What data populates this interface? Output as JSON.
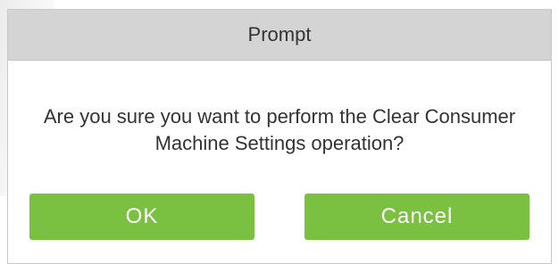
{
  "dialog": {
    "title": "Prompt",
    "message": "Are you sure you want to perform the Clear Consumer Machine Settings operation?",
    "buttons": {
      "ok_label": "OK",
      "cancel_label": "Cancel"
    },
    "colors": {
      "header_bg": "#d4d4d4",
      "button_bg": "#7ac142",
      "button_text": "#ffffff",
      "text": "#333333"
    }
  }
}
